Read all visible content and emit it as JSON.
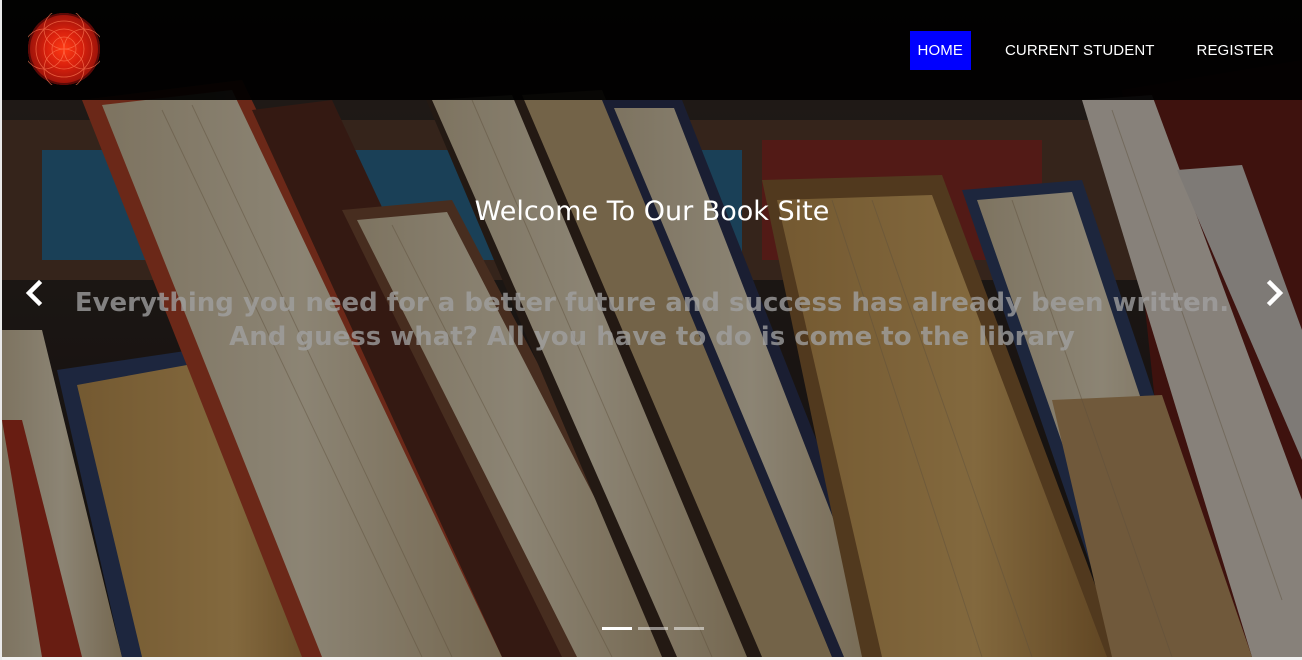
{
  "navbar": {
    "logo": "red-circular-emblem-logo",
    "items": [
      {
        "label": "HOME",
        "active": true
      },
      {
        "label": "CURRENT STUDENT",
        "active": false
      },
      {
        "label": "REGISTER",
        "active": false
      }
    ],
    "active_color": "#0000ff"
  },
  "hero": {
    "title": "Welcome To Our Book Site",
    "text_line1": "Everything you need for a better future and success has already been written.",
    "text_line2": "And guess what? All you have to do is come to the library",
    "background": "books-on-shelf-photo"
  },
  "carousel": {
    "prev_icon": "chevron-left-icon",
    "next_icon": "chevron-right-icon",
    "slide_count": 3,
    "active_slide": 1
  }
}
